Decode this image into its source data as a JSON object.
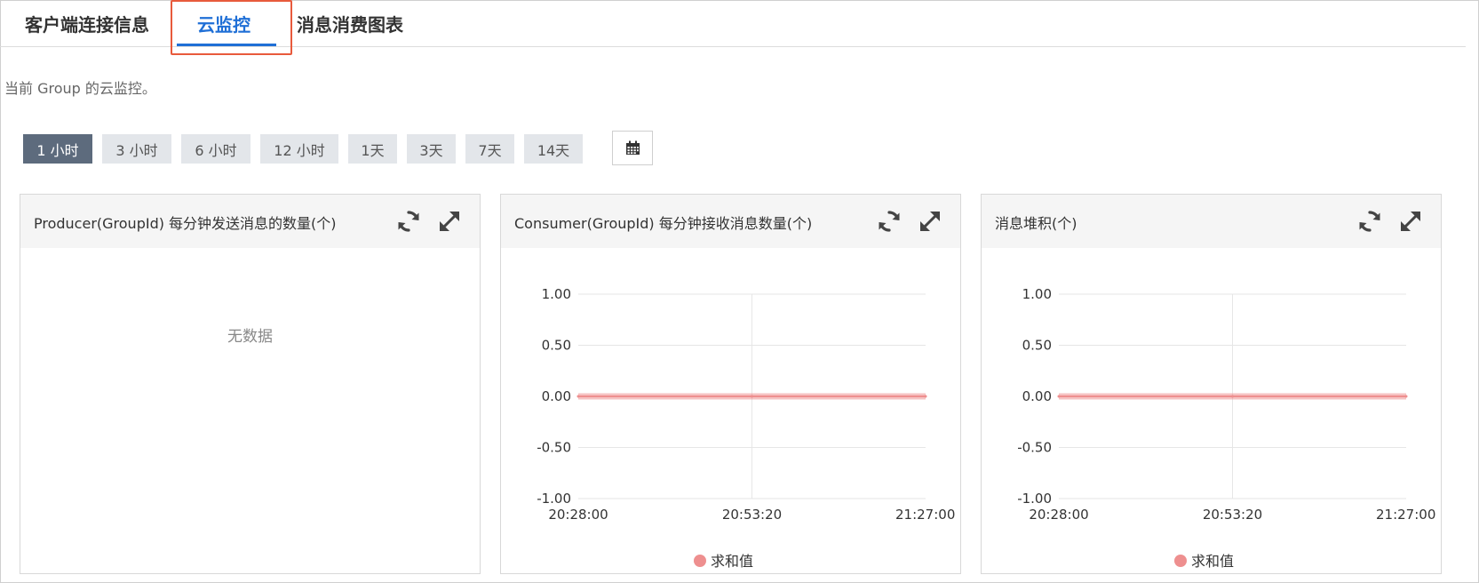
{
  "tabs": [
    {
      "label": "客户端连接信息",
      "active": false
    },
    {
      "label": "云监控",
      "active": true
    },
    {
      "label": "消息消费图表",
      "active": false
    }
  ],
  "description": "当前 Group 的云监控。",
  "time_ranges": [
    "1 小时",
    "3 小时",
    "6 小时",
    "12 小时",
    "1天",
    "3天",
    "7天",
    "14天"
  ],
  "active_range": "1 小时",
  "icons": {
    "calendar": "calendar-icon",
    "refresh": "refresh-icon",
    "expand": "expand-icon"
  },
  "colors": {
    "accent": "#1f6fd6",
    "highlight": "#e85a3c",
    "series": "#ee8f8f",
    "active_range_bg": "#5d6b7d"
  },
  "panels": [
    {
      "title": "Producer(GroupId) 每分钟发送消息的数量(个)",
      "empty_text": "无数据"
    },
    {
      "title": "Consumer(GroupId) 每分钟接收消息数量(个)"
    },
    {
      "title": "消息堆积(个)"
    }
  ],
  "chart_data": [
    {
      "type": "line",
      "x": [
        "20:28:00",
        "20:53:20",
        "21:27:00"
      ],
      "y_ticks": [
        "1.00",
        "0.50",
        "0.00",
        "-0.50",
        "-1.00"
      ],
      "ylim": [
        -1,
        1
      ],
      "series": [
        {
          "name": "求和值",
          "values": [
            0,
            0,
            0
          ]
        }
      ],
      "legend": "bottom-center",
      "grid": true
    },
    {
      "type": "line",
      "x": [
        "20:28:00",
        "20:53:20",
        "21:27:00"
      ],
      "y_ticks": [
        "1.00",
        "0.50",
        "0.00",
        "-0.50",
        "-1.00"
      ],
      "ylim": [
        -1,
        1
      ],
      "series": [
        {
          "name": "求和值",
          "values": [
            0,
            0,
            0
          ]
        }
      ],
      "legend": "bottom-center",
      "grid": true
    }
  ]
}
